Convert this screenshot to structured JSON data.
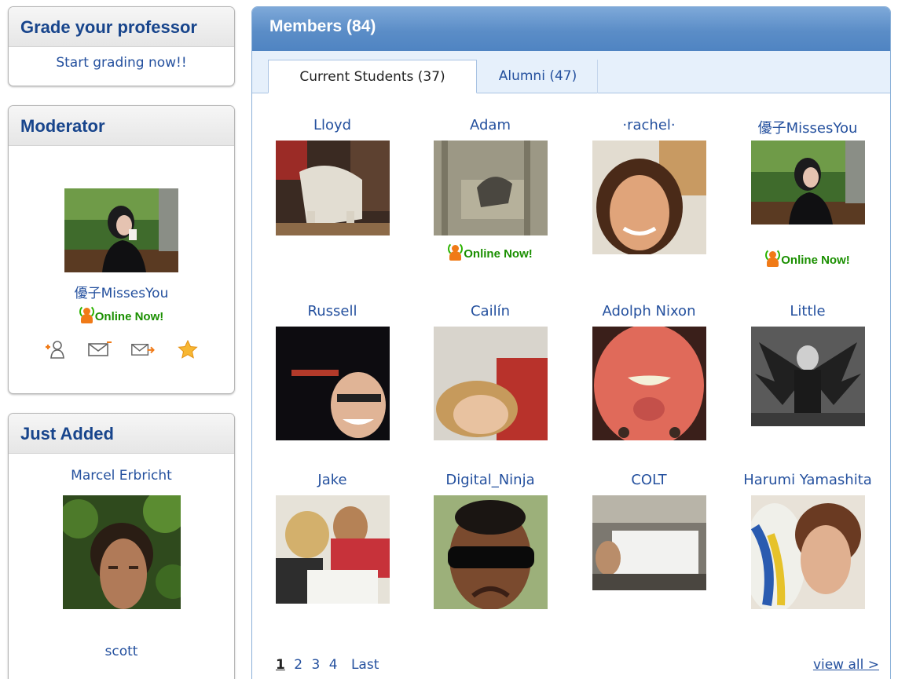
{
  "grade": {
    "title": "Grade your professor",
    "link": "Start grading now!!"
  },
  "moderator": {
    "title": "Moderator",
    "name": "優子MissesYou",
    "online": "Online Now!",
    "actions": [
      "add-friend-icon",
      "message-icon",
      "forward-message-icon",
      "favorite-star-icon"
    ]
  },
  "just_added": {
    "title": "Just Added",
    "name1": "Marcel Erbricht",
    "name2": "scott"
  },
  "members": {
    "title": "Members (84)",
    "tabs": [
      {
        "label": "Current Students (37)"
      },
      {
        "label": "Alumni (47)"
      }
    ],
    "people": [
      {
        "name": "Lloyd",
        "online": ""
      },
      {
        "name": "Adam",
        "online": "Online Now!"
      },
      {
        "name": "·rachel·",
        "online": ""
      },
      {
        "name": "優子MissesYou",
        "online": "Online Now!"
      },
      {
        "name": "Russell",
        "online": ""
      },
      {
        "name": "Cailín",
        "online": ""
      },
      {
        "name": "Adolph Nixon",
        "online": ""
      },
      {
        "name": "Little",
        "online": ""
      },
      {
        "name": "Jake",
        "online": ""
      },
      {
        "name": "Digital_Ninja",
        "online": ""
      },
      {
        "name": "COLT",
        "online": ""
      },
      {
        "name": "Harumi Yamashita",
        "online": ""
      }
    ],
    "pager": {
      "pages": [
        "1",
        "2",
        "3",
        "4"
      ],
      "last": "Last"
    },
    "view_all": "view all >"
  },
  "colors": {
    "link": "#24509e",
    "header_text": "#18458c",
    "online": "#1a8f00",
    "presence": "#f07a17"
  }
}
